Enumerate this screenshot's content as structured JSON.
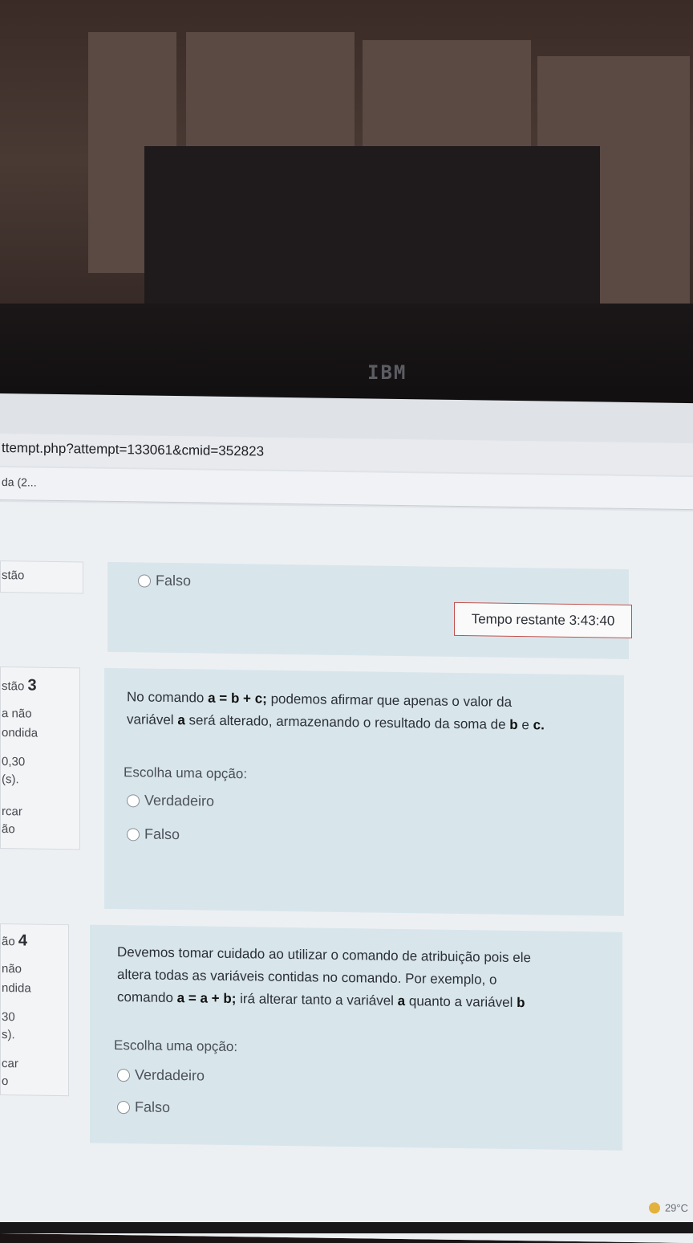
{
  "browser": {
    "url": "ttempt.php?attempt=133061&cmid=352823",
    "tab_title": "da (2..."
  },
  "timer": {
    "text": "Tempo restante 3:43:40"
  },
  "question2": {
    "nav_label": "stão",
    "option_falso": "Falso"
  },
  "question3": {
    "nav_title": "stão",
    "nav_number": "3",
    "nav_status_1": "a não",
    "nav_status_2": "ondida",
    "nav_score_1": "0,30",
    "nav_score_2": "(s).",
    "nav_flag_1": "rcar",
    "nav_flag_2": "ão",
    "text_1": "No comando",
    "code_1": "a = b + c;",
    "text_2": "podemos afirmar que apenas o valor da",
    "text_3": "variável",
    "var_a": "a",
    "text_4": "será alterado, armazenando o resultado da soma de",
    "var_b": "b",
    "text_e": "e",
    "var_c": "c.",
    "choose": "Escolha uma opção:",
    "option_true": "Verdadeiro",
    "option_false": "Falso"
  },
  "question4": {
    "nav_title": "ão",
    "nav_number": "4",
    "nav_status_1": "não",
    "nav_status_2": "ndida",
    "nav_score_1": "30",
    "nav_score_2": "s).",
    "nav_flag_1": "car",
    "nav_flag_2": "o",
    "line_1": "Devemos tomar cuidado ao utilizar o comando de atribuição pois ele",
    "line_2": "altera todas as variáveis contidas no comando. Por exemplo, o",
    "text_3a": "comando",
    "code": "a = a + b;",
    "text_3b": "irá alterar tanto a variável",
    "var_a": "a",
    "text_3c": "quanto a variável",
    "var_b": "b",
    "choose": "Escolha uma opção:",
    "option_true": "Verdadeiro",
    "option_false": "Falso"
  },
  "taskbar": {
    "temperature": "29°C"
  },
  "monitor": {
    "brand": "IBM"
  }
}
